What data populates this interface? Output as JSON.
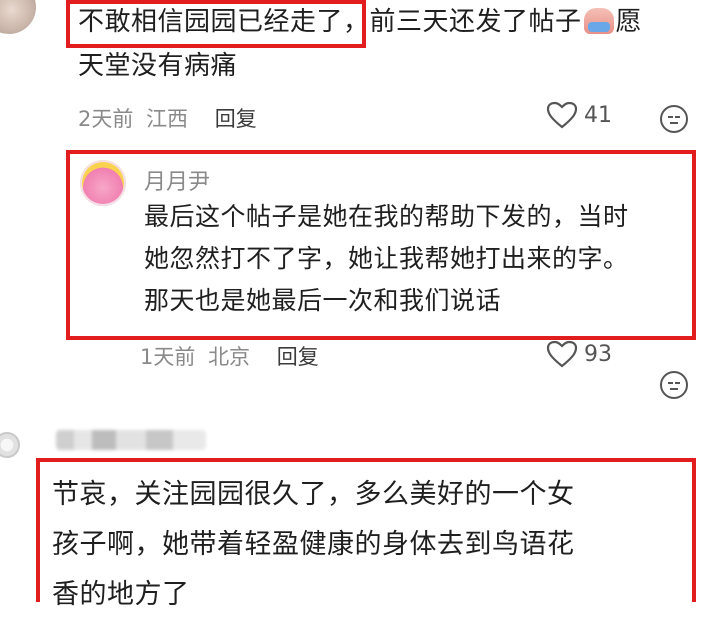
{
  "comment1": {
    "text_line1_highlight": "不敢相信园园已经走了",
    "text_line1_rest": "，前三天还发了帖子",
    "text_line1_tail": "愿",
    "text_line2": "天堂没有病痛",
    "time": "2天前",
    "location": "江西",
    "reply": "回复",
    "likes": "41"
  },
  "reply1": {
    "username": "月月尹",
    "lines": [
      "最后这个帖子是她在我的帮助下发的，当时",
      "她忽然打不了字，她让我帮她打出来的字。",
      "那天也是她最后一次和我们说话"
    ],
    "time": "1天前",
    "location": "北京",
    "reply": "回复",
    "likes": "93"
  },
  "comment2": {
    "lines": [
      "节哀，关注园园很久了，多么美好的一个女",
      "孩子啊，她带着轻盈健康的身体去到鸟语花",
      "香的地方了"
    ]
  },
  "icons": [
    "avatar",
    "crying-emoji",
    "heart-icon",
    "emoji-face-icon"
  ]
}
